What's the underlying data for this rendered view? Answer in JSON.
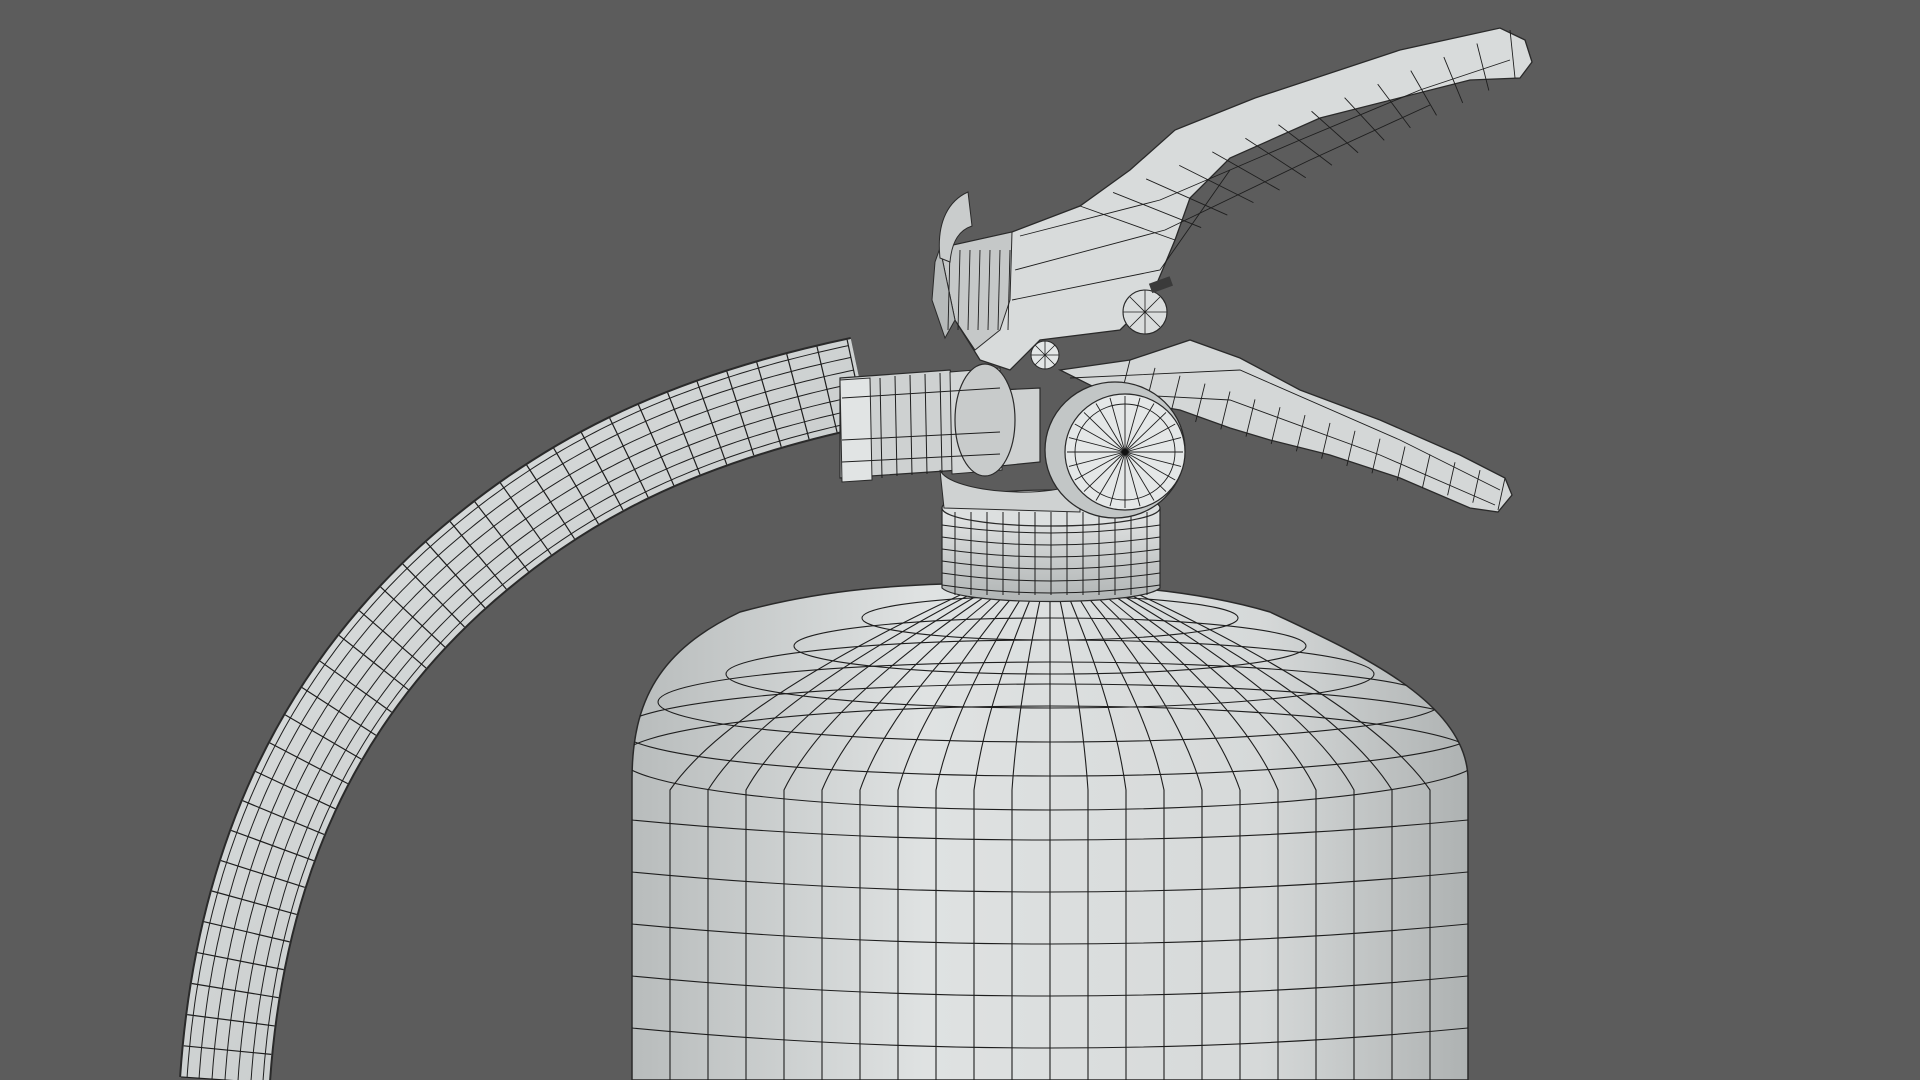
{
  "scene": {
    "subject": "fire-extinguisher-wireframe-render",
    "background_color": "#5c5c5c",
    "surface_color": "#d9dcdc",
    "surface_shadow_color": "#a9adad",
    "wire_color": "#1e1e1e",
    "parts": [
      "cylinder-body",
      "neck",
      "valve-head",
      "carry-handle",
      "trigger-lever",
      "pressure-gauge",
      "hose-coupling",
      "hose"
    ]
  }
}
